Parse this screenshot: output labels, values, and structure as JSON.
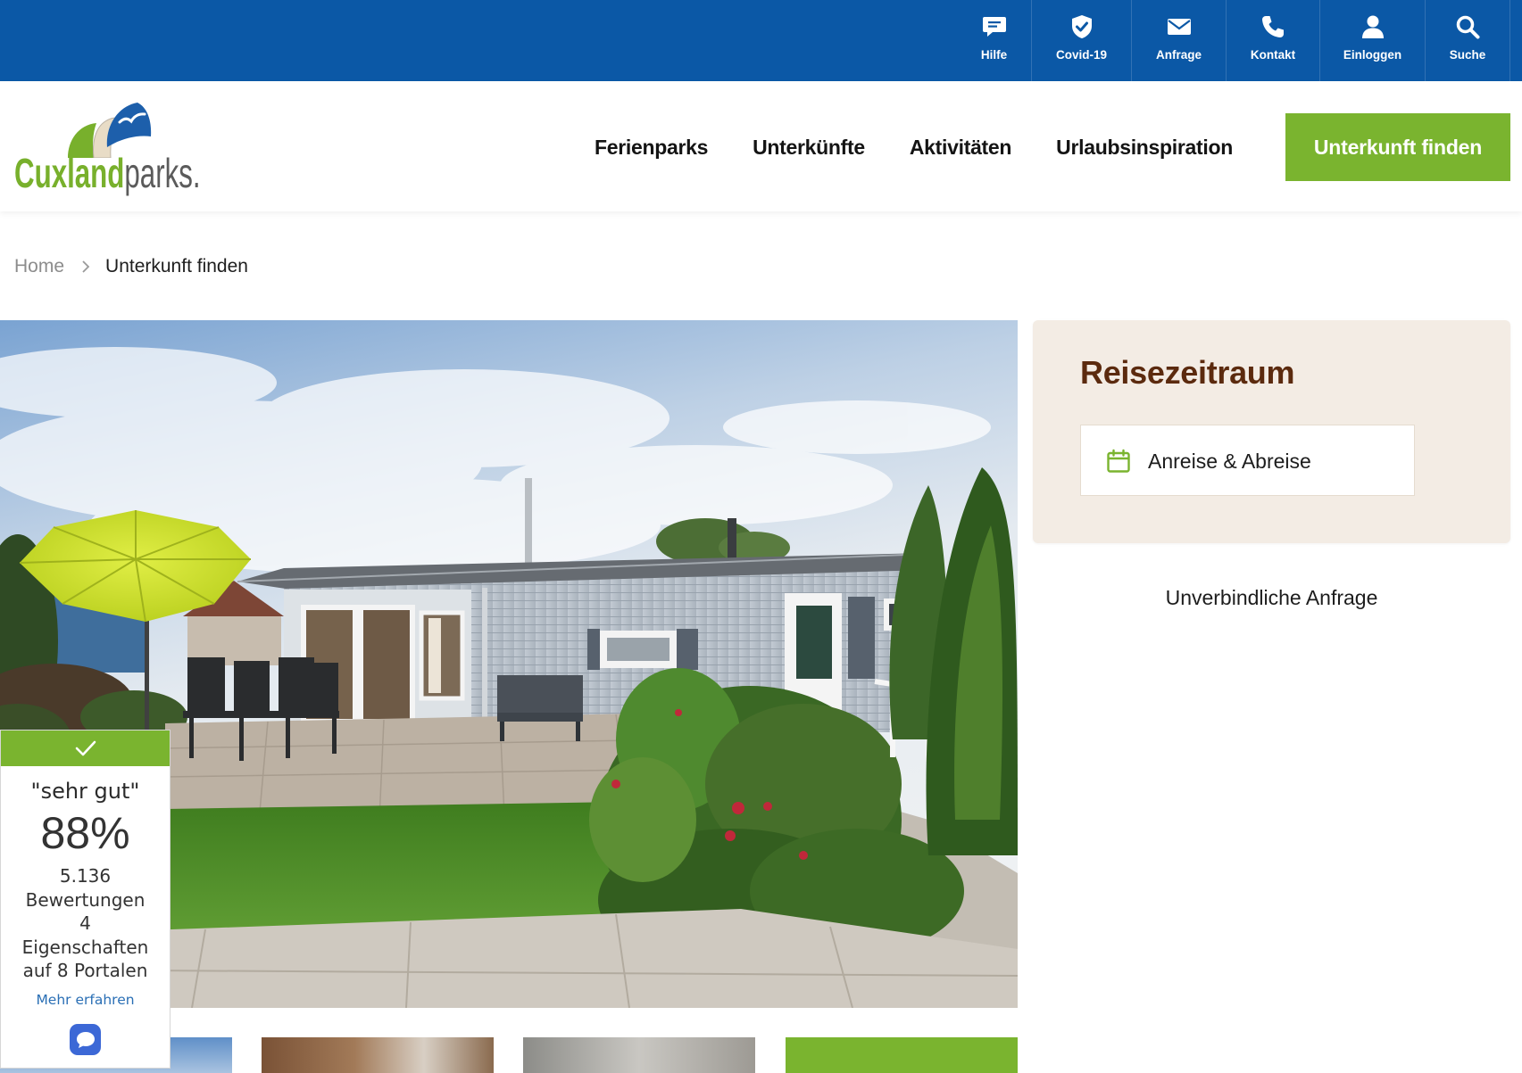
{
  "topbar": {
    "items": [
      {
        "label": "Hilfe",
        "icon": "chat-bubble-icon"
      },
      {
        "label": "Covid-19",
        "icon": "shield-check-icon"
      },
      {
        "label": "Anfrage",
        "icon": "envelope-icon"
      },
      {
        "label": "Kontakt",
        "icon": "phone-icon"
      },
      {
        "label": "Einloggen",
        "icon": "user-icon"
      },
      {
        "label": "Suche",
        "icon": "search-icon"
      }
    ]
  },
  "logo": {
    "brand": "Cuxland",
    "suffix": "parks."
  },
  "nav": {
    "items": [
      {
        "label": "Ferienparks"
      },
      {
        "label": "Unterkünfte"
      },
      {
        "label": "Aktivitäten"
      },
      {
        "label": "Urlaubsinspiration"
      }
    ],
    "cta_label": "Unterkunft finden"
  },
  "breadcrumb": {
    "items": [
      {
        "label": "Home"
      },
      {
        "label": "Unterkunft finden"
      }
    ],
    "separator_icon": "chevron-right-icon"
  },
  "booking": {
    "title": "Reisezeitraum",
    "date_field": {
      "value": "Anreise & Abreise",
      "icon": "calendar-icon"
    },
    "inquiry_link": "Unverbindliche Anfrage"
  },
  "rating_widget": {
    "header_icon": "checkmark-icon",
    "verdict": "\"sehr gut\"",
    "score": "88%",
    "reviews_count": "5.136",
    "reviews_label": "Bewertungen",
    "properties_count": "4",
    "properties_label": "Eigenschaften",
    "portals_text": "auf 8 Portalen",
    "more_link": "Mehr erfahren",
    "chat_icon": "chat-bubble-icon"
  },
  "colors": {
    "topbar_blue": "#0b58a6",
    "brand_green": "#7ab42f",
    "title_brown": "#5b2a0e",
    "panel_background": "#f3ece4",
    "link_blue": "#2a6fb5",
    "chat_blue": "#3c68d6"
  }
}
